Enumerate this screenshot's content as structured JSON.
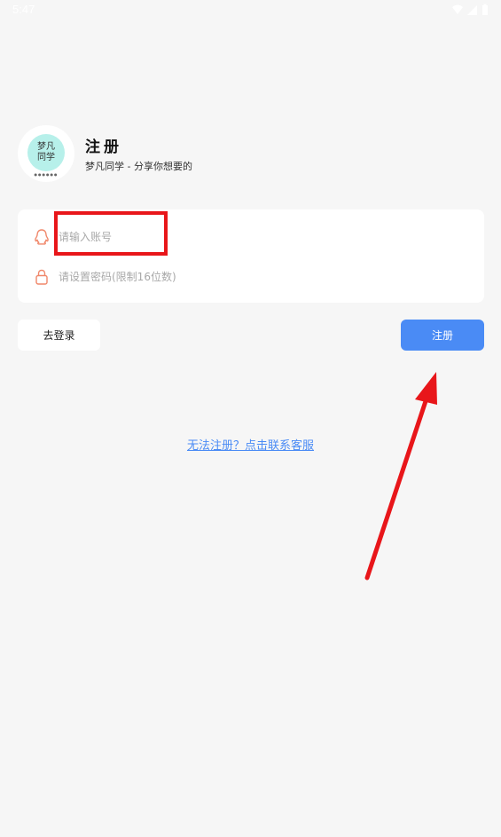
{
  "status_bar": {
    "time": "5:47"
  },
  "header": {
    "logo_line1": "梦凡",
    "logo_line2": "同学",
    "logo_sub": "●●●●●●",
    "title": "注册",
    "subtitle": "梦凡同学 - 分享你想要的"
  },
  "form": {
    "account_placeholder": "请输入账号",
    "account_value": "",
    "password_placeholder": "请设置密码(限制16位数)",
    "password_value": ""
  },
  "buttons": {
    "login_label": "去登录",
    "register_label": "注册"
  },
  "help_link": "无法注册？点击联系客服",
  "colors": {
    "accent": "#4a8bf5",
    "icon_orange": "#f0876a",
    "annotation_red": "#e8161a",
    "logo_bg": "#b7f0ea"
  },
  "icons": {
    "account": "qq-penguin-icon",
    "password": "lock-icon"
  }
}
